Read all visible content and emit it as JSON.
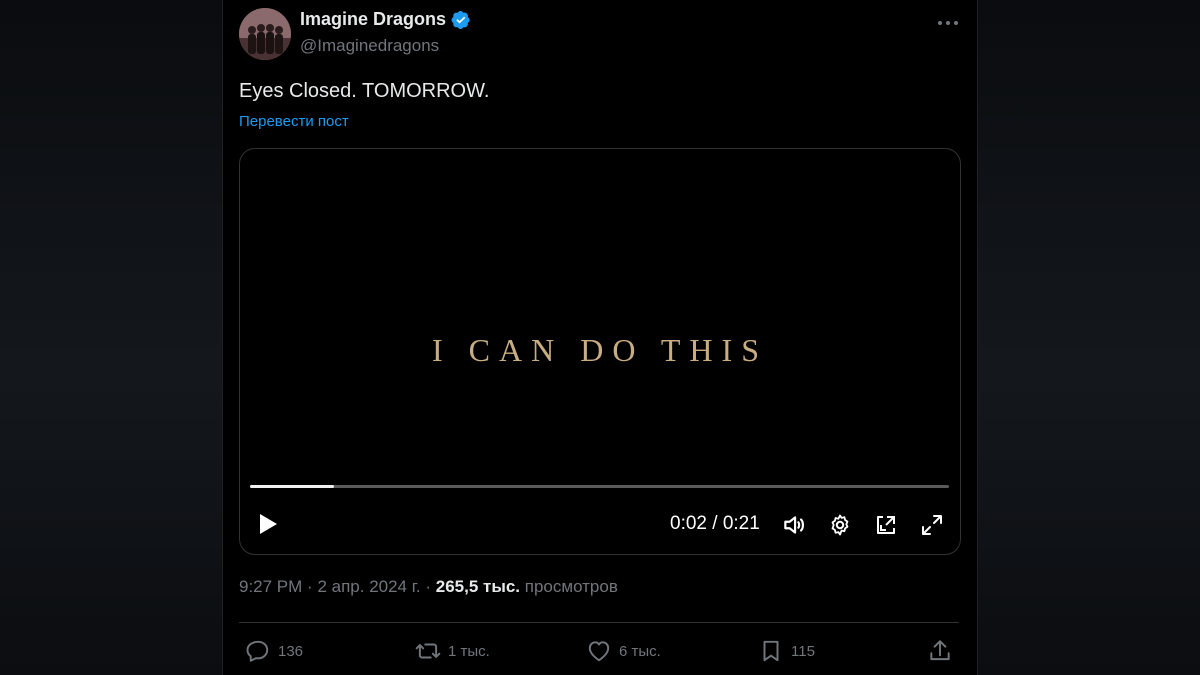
{
  "author": {
    "name": "Imagine Dragons",
    "handle": "@Imaginedragons"
  },
  "tweet": {
    "text": "Eyes Closed. TOMORROW.",
    "translate_label": "Перевести пост"
  },
  "video": {
    "caption": "I CAN DO THIS",
    "current_time": "0:02",
    "separator": "/",
    "duration": "0:21",
    "progress_fraction": 0.12
  },
  "meta": {
    "time": "9:27 PM",
    "dot1": "·",
    "date": "2 апр. 2024 г.",
    "dot2": "·",
    "views_count": "265,5 тыс.",
    "views_label": "просмотров"
  },
  "actions": {
    "replies": "136",
    "reposts": "1 тыс.",
    "likes": "6 тыс.",
    "bookmarks": "115"
  },
  "colors": {
    "accent": "#1d9bf0",
    "caption": "#c9ad82",
    "secondary_text": "#71767b"
  }
}
